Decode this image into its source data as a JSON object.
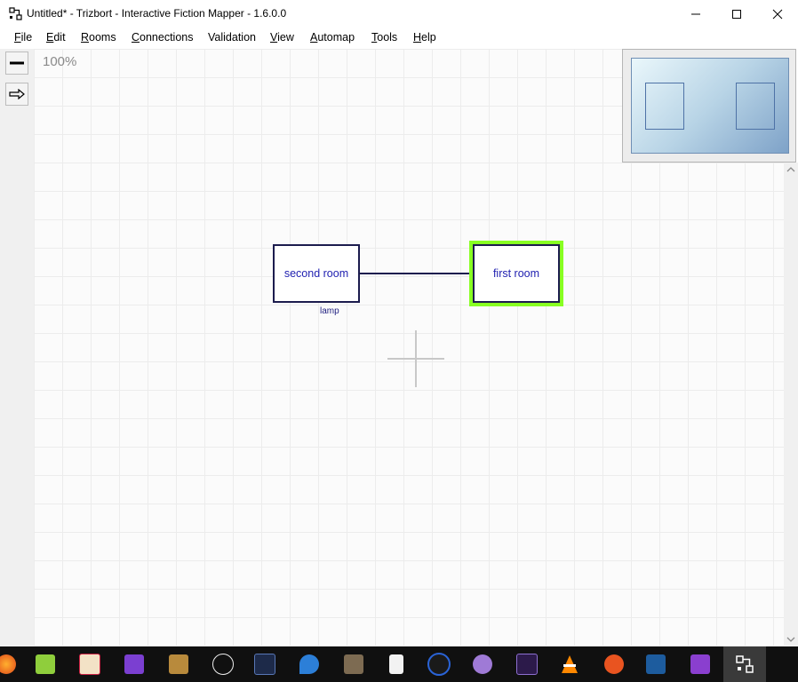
{
  "window": {
    "title": "Untitled* - Trizbort - Interactive Fiction Mapper - 1.6.0.0",
    "controls": [
      "minimize",
      "maximize",
      "close"
    ]
  },
  "menu": {
    "items": [
      {
        "first": "F",
        "rest": "ile"
      },
      {
        "first": "E",
        "rest": "dit"
      },
      {
        "first": "R",
        "rest": "ooms"
      },
      {
        "first": "C",
        "rest": "onnections"
      },
      {
        "first": "",
        "rest": "Validation"
      },
      {
        "first": "V",
        "rest": "iew"
      },
      {
        "first": "A",
        "rest": "utomap"
      },
      {
        "first": "T",
        "rest": "ools"
      },
      {
        "first": "H",
        "rest": "elp"
      }
    ]
  },
  "toolbar": {
    "tools": [
      {
        "icon": "line-tool-icon"
      },
      {
        "icon": "arrow-tool-icon"
      }
    ]
  },
  "canvas": {
    "zoom": "100%",
    "rooms": [
      {
        "name": "second room",
        "object": "lamp",
        "selected": false
      },
      {
        "name": "first room",
        "object": "",
        "selected": true
      }
    ],
    "selection_color": "#88ff22",
    "room_border_color": "#1c1c4e",
    "room_text_color": "#1f1fb0"
  },
  "taskbar": {
    "apps": [
      "firefox-icon",
      "notepad-plus-icon",
      "map-icon",
      "visual-studio-icon",
      "dosbox-icon",
      "unity-icon",
      "xd-icon",
      "blue-leaf-icon",
      "gimp-icon",
      "document-icon",
      "audio-icon",
      "github-icon",
      "premiere-icon",
      "vlc-icon",
      "ubuntu-icon",
      "virtualbox-icon",
      "mendix-icon",
      "trizbort-icon"
    ]
  }
}
